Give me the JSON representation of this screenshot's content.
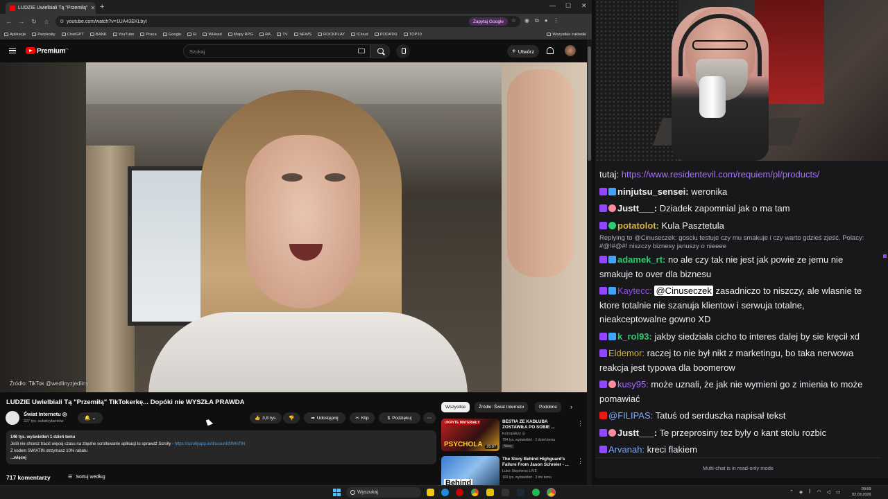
{
  "browser": {
    "tab_title": "LUDZIE Uwielbiali Tą \"Przemiłą\"",
    "url": "youtube.com/watch?v=1UA43EKLbyI",
    "ask_google": "Zapytaj Google",
    "bookmarks": [
      "Aplikacje",
      "Perplexity",
      "ChatGPT",
      "BANK",
      "YouTube",
      "Praca",
      "Google",
      "El",
      "WHead",
      "Mapy RPG",
      "RA",
      "TV",
      "NEWS",
      "ROCKPLAY",
      "iCloud",
      "PODATKI",
      "TOP10"
    ],
    "all_bookmarks": "Wszystkie zakładki"
  },
  "youtube": {
    "logo_text": "Premium",
    "logo_sup": "PL",
    "search_placeholder": "Szukaj",
    "create_label": "Utwórz",
    "video_source": "Źródło: TikTok @wedlinyzjedliny",
    "video_title": "LUDZIE Uwielbiali Tą \"Przemiłą\" TikTokerkę... Dopóki nie WYSZŁA PRAWDA",
    "channel_name": "Świat Internetu ◎",
    "channel_subs": "227 tys. subskrybentów",
    "likes": "3,8 tys.",
    "share": "Udostępnij",
    "clip": "Klip",
    "thanks": "Podziękuj",
    "desc_stats": "146 tys. wyświetleń  1 dzień temu",
    "desc_line1": "Jeśli nie chcesz tracić więcej czasu na zbędne scrollowanie aplikacji to sprawdź Scrolly - ",
    "desc_link": "https://scrollyapp.io/discount/SWIATIN",
    "desc_line2": "Z kodem SWIATIN otrzymasz 10% rabatu",
    "desc_more": "...więcej",
    "comments_count": "717 komentarzy",
    "sort_label": "Sortuj według",
    "chips": [
      "Wszystkie",
      "Źródło: Świat Internetu",
      "Podobne"
    ],
    "recs": [
      {
        "title": "BESTIA ZE KADŁUBA ZOSTAWIŁA PO SOBIE ...",
        "channel": "Konopskyy ◎",
        "views": "794 tys. wyświetleń · 1 dzień temu",
        "badge": "Nowy",
        "duration": "29:07",
        "thumb_text": "PSYCHOLA",
        "thumb_top": "UKRYTE MATERIAŁY"
      },
      {
        "title": "The Story Behind Highguard's Failure From Jason Schreier - ...",
        "channel": "Luke Stephens LIVE",
        "views": "103 tys. wyświetleń · 3 dni temu",
        "badge": "",
        "duration": "",
        "thumb_text": "Behind",
        "thumb_top": ""
      }
    ]
  },
  "chat": {
    "top_line": "tutaj: ",
    "top_link": "https://www.residentevil.com/requiem/pl/products/",
    "messages": [
      {
        "nick": "ninjutsu_sensei:",
        "color": "#efeff1",
        "text": " weronika",
        "badges": [
          "p",
          "t"
        ]
      },
      {
        "nick": "Justt___:",
        "color": "#efeff1",
        "text": " Dziadek zapomnial jak o ma tam",
        "badges": [
          "p",
          "s"
        ]
      },
      {
        "nick": "potatolot:",
        "color": "#d6b43a",
        "text": " Kula Pasztetula",
        "badges": [
          "p",
          "g"
        ]
      },
      {
        "nick": "adamek_rt:",
        "color": "#2ecc71",
        "text": "  no ale czy tak nie jest jak powie ze jemu nie smakuje to over dla biznesu",
        "badges": [
          "p",
          "t"
        ]
      },
      {
        "nick": "Kaytecc:",
        "color": "#9147ff",
        "mention": "@Cinuseczek",
        "text": " zasadniczo to niszczy, ale wlasnie te ktore totalnie nie szanuja klientow i serwuja totalne, nieakceptowalne gowno XD",
        "badges": [
          "p",
          "t"
        ]
      },
      {
        "nick": "k_rol93:",
        "color": "#2ecc71",
        "text": " jakby siedziała cicho to interes dalej by sie kręcił xd",
        "badges": [
          "p",
          "t"
        ]
      },
      {
        "nick": "Eldemor:",
        "color": "#d6b43a",
        "text": " raczej to nie był nikt z marketingu, bo taka nerwowa reakcja jest typowa dla boomerow",
        "badges": [
          "p"
        ]
      },
      {
        "nick": "kusy95:",
        "color": "#a970ff",
        "text": " może uznali, że jak nie wymieni go z imienia to może pomawiać",
        "badges": [
          "p",
          "s"
        ]
      },
      {
        "nick": "@FILIPAS:",
        "color": "#7aa8ff",
        "text": " Tatuś od serduszka napisał tekst",
        "badges": [
          "r"
        ]
      },
      {
        "nick": "Justt___:",
        "color": "#efeff1",
        "text": " Te przeprosiny tez byly o kant stolu rozbic",
        "badges": [
          "p",
          "s"
        ]
      },
      {
        "nick": "Arvanah:",
        "color": "#7aa8ff",
        "text": " kreci flakiem",
        "badges": [
          "p"
        ]
      }
    ],
    "reply": "Replying to @Cinuseczek: gosciu testuje czy mu smakuje i czy warto gdzieś zjeść. Polacy: #@!#@#! niszczy biznesy januszy o nieeee",
    "footer": "Multi-chat is in read-only mode"
  },
  "taskbar": {
    "search": "Wyszukaj",
    "time": "09:59",
    "date": "02.03.2026"
  }
}
